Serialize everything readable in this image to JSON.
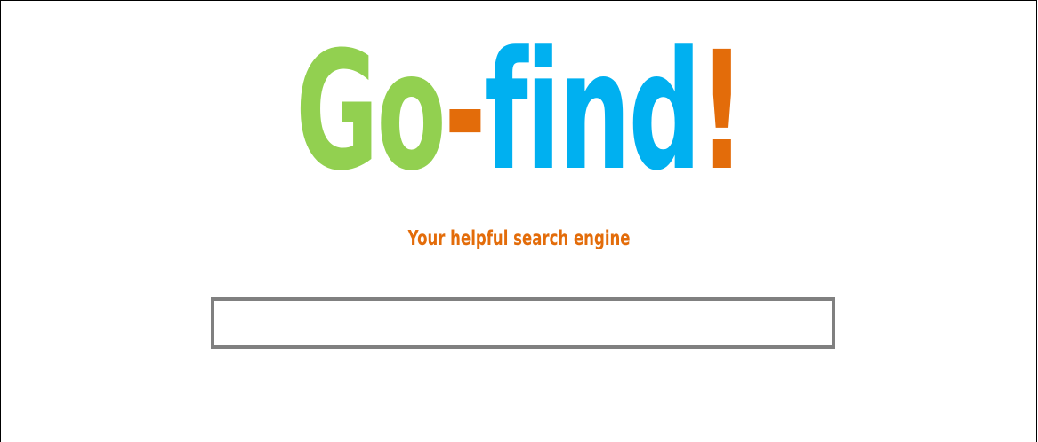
{
  "logo": {
    "part1": "Go",
    "part2": "-",
    "part3": "find",
    "part4": "!"
  },
  "tagline": "Your helpful search engine",
  "search": {
    "value": "",
    "placeholder": ""
  },
  "colors": {
    "green": "#92d050",
    "orange": "#e36c0a",
    "blue": "#00b0f0",
    "input_border": "#808080",
    "frame_border": "#000000"
  }
}
